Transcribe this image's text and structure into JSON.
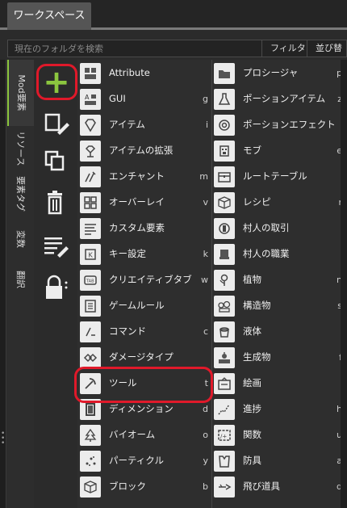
{
  "tab": {
    "label": "ワークスペース"
  },
  "search": {
    "placeholder": "現在のフォルダを検索",
    "filter_label": "フィルタ",
    "sort_label": "並び替え"
  },
  "vertical_tabs": [
    "Mod要素",
    "リソース",
    "要素タグ",
    "変数",
    "翻訳"
  ],
  "toolbar": {
    "add": "add-element",
    "new": "new-file",
    "duplicate": "duplicate",
    "delete": "delete",
    "edit_list": "edit-list",
    "lock": "lock"
  },
  "left_column": [
    {
      "label": "Attribute",
      "key": "",
      "icon": "attribute-icon"
    },
    {
      "label": "GUI",
      "key": "g",
      "icon": "gui-icon"
    },
    {
      "label": "アイテム",
      "key": "i",
      "icon": "gem-icon"
    },
    {
      "label": "アイテムの拡張",
      "key": "",
      "icon": "item-extension-icon"
    },
    {
      "label": "エンチャント",
      "key": "m",
      "icon": "enchant-icon"
    },
    {
      "label": "オーバーレイ",
      "key": "v",
      "icon": "overlay-icon"
    },
    {
      "label": "カスタム要素",
      "key": "",
      "icon": "custom-element-icon"
    },
    {
      "label": "キー設定",
      "key": "k",
      "icon": "keybind-icon"
    },
    {
      "label": "クリエイティブタブ",
      "key": "w",
      "icon": "creative-tab-icon"
    },
    {
      "label": "ゲームルール",
      "key": "",
      "icon": "gamerule-icon"
    },
    {
      "label": "コマンド",
      "key": "c",
      "icon": "command-icon"
    },
    {
      "label": "ダメージタイプ",
      "key": "",
      "icon": "damage-type-icon"
    },
    {
      "label": "ツール",
      "key": "t",
      "icon": "tool-icon"
    },
    {
      "label": "ディメンション",
      "key": "d",
      "icon": "dimension-icon"
    },
    {
      "label": "バイオーム",
      "key": "o",
      "icon": "biome-icon"
    },
    {
      "label": "パーティクル",
      "key": "y",
      "icon": "particle-icon"
    },
    {
      "label": "ブロック",
      "key": "b",
      "icon": "block-icon"
    }
  ],
  "right_column": [
    {
      "label": "プロシージャ",
      "key": "p",
      "icon": "procedure-icon"
    },
    {
      "label": "ポーションアイテム",
      "key": "z",
      "icon": "potion-item-icon"
    },
    {
      "label": "ポーションエフェクト",
      "key": "",
      "icon": "potion-effect-icon"
    },
    {
      "label": "モブ",
      "key": "e",
      "icon": "mob-icon"
    },
    {
      "label": "ルートテーブル",
      "key": "l",
      "icon": "loot-table-icon"
    },
    {
      "label": "レシピ",
      "key": "r",
      "icon": "recipe-icon"
    },
    {
      "label": "村人の取引",
      "key": "",
      "icon": "villager-trade-icon"
    },
    {
      "label": "村人の職業",
      "key": "",
      "icon": "villager-profession-icon"
    },
    {
      "label": "植物",
      "key": "n",
      "icon": "plant-icon"
    },
    {
      "label": "構造物",
      "key": "s",
      "icon": "structure-icon"
    },
    {
      "label": "液体",
      "key": "",
      "icon": "fluid-icon"
    },
    {
      "label": "生成物",
      "key": "f",
      "icon": "feature-icon"
    },
    {
      "label": "絵画",
      "key": "",
      "icon": "painting-icon"
    },
    {
      "label": "進捗",
      "key": "h",
      "icon": "advancement-icon"
    },
    {
      "label": "関数",
      "key": "u",
      "icon": "function-icon"
    },
    {
      "label": "防具",
      "key": "a",
      "icon": "armor-icon"
    },
    {
      "label": "飛び道具",
      "key": "q",
      "icon": "projectile-icon"
    }
  ],
  "colors": {
    "accent": "#8cc63f",
    "highlight": "#e0192a",
    "background": "#2b2b2b"
  }
}
